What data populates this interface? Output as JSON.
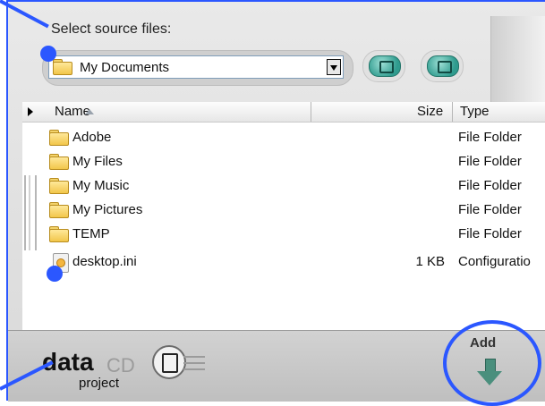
{
  "header": {
    "title": "Select source files:"
  },
  "source_select": {
    "value": "My Documents"
  },
  "columns": {
    "name": "Name",
    "size": "Size",
    "type": "Type"
  },
  "rows": [
    {
      "name": "Adobe",
      "size": "",
      "type": "File Folder",
      "icon": "folder-icon"
    },
    {
      "name": "My Files",
      "size": "",
      "type": "File Folder",
      "icon": "folder-icon"
    },
    {
      "name": "My Music",
      "size": "",
      "type": "File Folder",
      "icon": "folder-icon"
    },
    {
      "name": "My Pictures",
      "size": "",
      "type": "File Folder",
      "icon": "folder-icon"
    },
    {
      "name": "TEMP",
      "size": "",
      "type": "File Folder",
      "icon": "folder-icon"
    },
    {
      "name": "desktop.ini",
      "size": "1 KB",
      "type": "Configuratio",
      "icon": "ini-file-icon"
    }
  ],
  "footer": {
    "logo_main": "data",
    "logo_cd": "CD",
    "logo_sub": "project",
    "add_label": "Add"
  },
  "colors": {
    "callout": "#2b57ff",
    "accent": "#2f9b8e"
  }
}
